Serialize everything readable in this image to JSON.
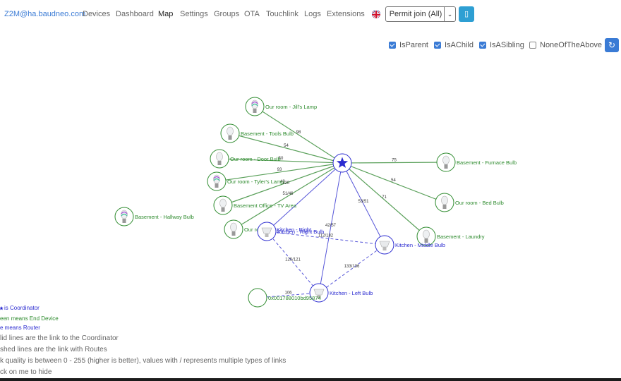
{
  "nav": {
    "brand": "Z2M@ha.baudneo.com",
    "items": [
      {
        "label": "Devices",
        "active": false
      },
      {
        "label": "Dashboard",
        "active": false
      },
      {
        "label": "Map",
        "active": true
      },
      {
        "label": "Settings",
        "active": false
      },
      {
        "label": "Groups",
        "active": false
      },
      {
        "label": "OTA",
        "active": false
      },
      {
        "label": "Touchlink",
        "active": false
      },
      {
        "label": "Logs",
        "active": false
      },
      {
        "label": "Extensions",
        "active": false
      }
    ],
    "language_icon": "uk-flag-icon",
    "permit_join": "Permit join (All)",
    "permit_caret_icon": "chevron-down-icon",
    "permit_timer_icon": "phone-icon"
  },
  "filters": [
    {
      "label": "IsParent",
      "checked": true
    },
    {
      "label": "IsAChild",
      "checked": true
    },
    {
      "label": "IsASibling",
      "checked": true
    },
    {
      "label": "NoneOfTheAbove",
      "checked": false
    }
  ],
  "refresh_icon": "refresh-icon",
  "colors": {
    "end_device": "#2e8b2e",
    "router": "#2b2bd0",
    "coordinator": "#2b2bd0",
    "link_coord": "#5aa05a",
    "link_router": "#5555d8"
  },
  "map": {
    "coordinator": {
      "label": ""
    },
    "nodes": [
      {
        "id": "jill",
        "label": "Our room - Jill's Lamp",
        "type": "end",
        "icon": "color-bulb-icon"
      },
      {
        "id": "tools",
        "label": "Basement - Tools Bulb",
        "type": "end",
        "icon": "bulb-icon"
      },
      {
        "id": "door",
        "label": "Our room - Door Bulb",
        "type": "end",
        "icon": "bulb-icon"
      },
      {
        "id": "tyler",
        "label": "Our room - Tyler's Lamp",
        "type": "end",
        "icon": "color-bulb-icon"
      },
      {
        "id": "office",
        "label": "Basement Office - TV Area",
        "type": "end",
        "icon": "bulb-icon"
      },
      {
        "id": "hallway",
        "label": "Basement - Hallway Bulb",
        "type": "end",
        "icon": "color-bulb-icon"
      },
      {
        "id": "ourroom2",
        "label": "Our room - ...",
        "type": "end",
        "icon": "bulb-icon"
      },
      {
        "id": "furnace",
        "label": "Basement - Furnace Bulb",
        "type": "end",
        "icon": "bulb-icon"
      },
      {
        "id": "bed",
        "label": "Our room - Bed Bulb",
        "type": "end",
        "icon": "bulb-icon"
      },
      {
        "id": "laundry",
        "label": "Basement - Laundry",
        "type": "end",
        "icon": "white-bulb-icon"
      },
      {
        "id": "kright",
        "label": "Kitchen - Right Bulb",
        "type": "router",
        "icon": "spot-bulb-icon"
      },
      {
        "id": "kmiddle",
        "label": "Kitchen - Middle Bulb",
        "type": "router",
        "icon": "spot-bulb-icon"
      },
      {
        "id": "kleft",
        "label": "Kitchen - Left Bulb",
        "type": "router",
        "icon": "spot-bulb-icon"
      },
      {
        "id": "unknown",
        "label": "0x001788010bd95874",
        "type": "end",
        "icon": "unknown-device-icon"
      }
    ],
    "links": [
      {
        "from": "coord",
        "to": "jill",
        "lqi": "98",
        "type": "coord"
      },
      {
        "from": "coord",
        "to": "tools",
        "lqi": "54",
        "type": "coord"
      },
      {
        "from": "coord",
        "to": "door",
        "lqi": "50",
        "type": "coord"
      },
      {
        "from": "coord",
        "to": "tyler",
        "lqi": "93",
        "type": "coord"
      },
      {
        "from": "coord",
        "to": "office",
        "lqi": "43",
        "type": "coord"
      },
      {
        "from": "coord",
        "to": "ourroom2",
        "lqi": "51/46",
        "type": "coord"
      },
      {
        "from": "coord",
        "to": "furnace",
        "lqi": "75",
        "type": "coord"
      },
      {
        "from": "coord",
        "to": "bed",
        "lqi": "54",
        "type": "coord"
      },
      {
        "from": "coord",
        "to": "laundry",
        "lqi": "71",
        "type": "coord"
      },
      {
        "from": "coord",
        "to": "kright",
        "lqi": "",
        "type": "router"
      },
      {
        "from": "coord",
        "to": "kmiddle",
        "lqi": "53/51",
        "type": "router"
      },
      {
        "from": "coord",
        "to": "kleft",
        "lqi": "42/57",
        "type": "router"
      },
      {
        "from": "kright",
        "to": "kmiddle",
        "lqi": "112/182",
        "type": "route"
      },
      {
        "from": "kright",
        "to": "kleft",
        "lqi": "125/121",
        "type": "route"
      },
      {
        "from": "kmiddle",
        "to": "kleft",
        "lqi": "133/136",
        "type": "route"
      },
      {
        "from": "kleft",
        "to": "unknown",
        "lqi": "106",
        "type": "route"
      },
      {
        "from": "tyler",
        "to": "tyler",
        "lqi": "120",
        "type": "none"
      }
    ],
    "extra_labels": [
      "Kitchen - Right ..."
    ]
  },
  "legend": [
    {
      "text": "is Coordinator",
      "color": "#2b2bd0"
    },
    {
      "text": "een means End Device",
      "color": "#2e8b2e"
    },
    {
      "text": "e means Router",
      "color": "#2b2bd0"
    }
  ],
  "help": [
    "lid lines are the link to the Coordinator",
    "shed lines are the link with Routes",
    "k quality is between 0 - 255 (higher is better), values with / represents multiple types of links",
    "ck on me to hide"
  ]
}
